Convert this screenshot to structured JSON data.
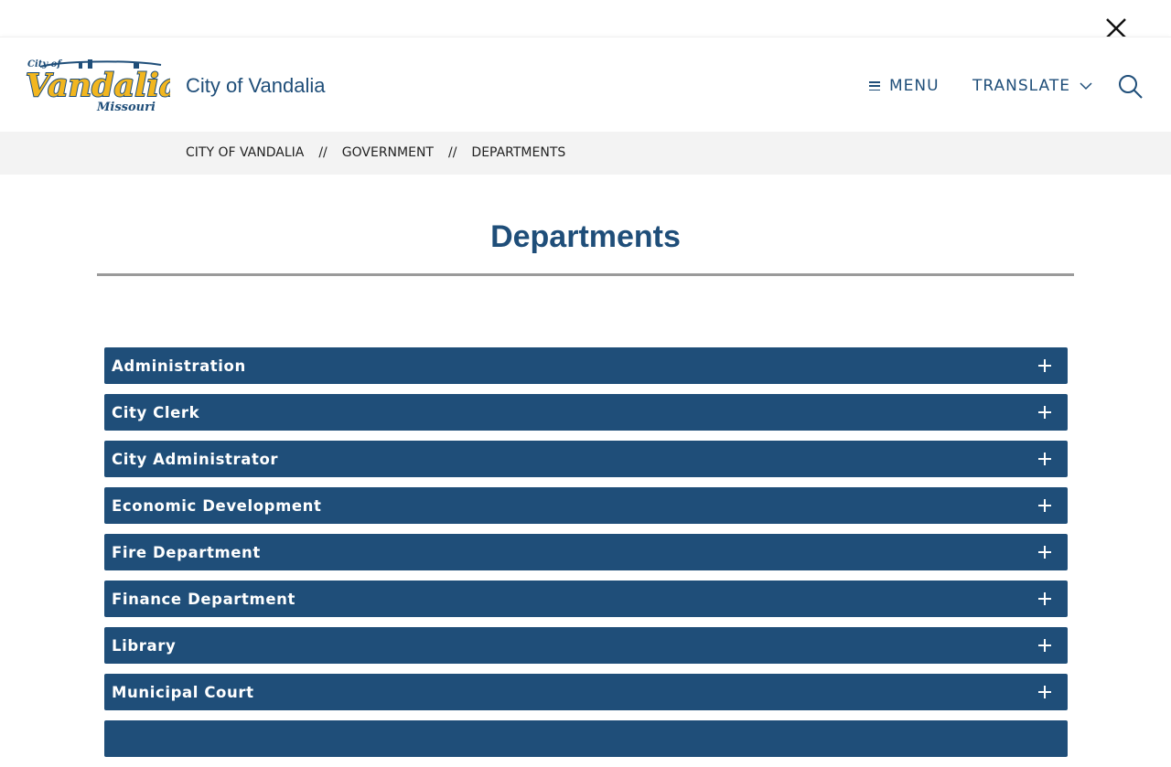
{
  "header": {
    "site_name": "City of Vandalia",
    "logo_text": {
      "top": "City of",
      "main": "Vandalia",
      "sub": "Missouri"
    },
    "menu_label": "MENU",
    "translate_label": "TRANSLATE"
  },
  "breadcrumb": {
    "items": [
      "CITY OF VANDALIA",
      "GOVERNMENT",
      "DEPARTMENTS"
    ],
    "separator": "//"
  },
  "page": {
    "title": "Departments"
  },
  "accordion": {
    "items": [
      {
        "label": "Administration"
      },
      {
        "label": "City Clerk"
      },
      {
        "label": "City Administrator"
      },
      {
        "label": "Economic Development"
      },
      {
        "label": "Fire Department"
      },
      {
        "label": "Finance Department"
      },
      {
        "label": "Library"
      },
      {
        "label": "Municipal Court"
      },
      {
        "label": ""
      }
    ]
  },
  "colors": {
    "primary": "#1f4e79",
    "logo_gold": "#f2b61f",
    "breadcrumb_bg": "#f3f3f3",
    "rule": "#9a9a9a"
  },
  "icons": [
    "close-icon",
    "menu-icon",
    "chevron-down-icon",
    "search-icon",
    "plus-icon"
  ]
}
